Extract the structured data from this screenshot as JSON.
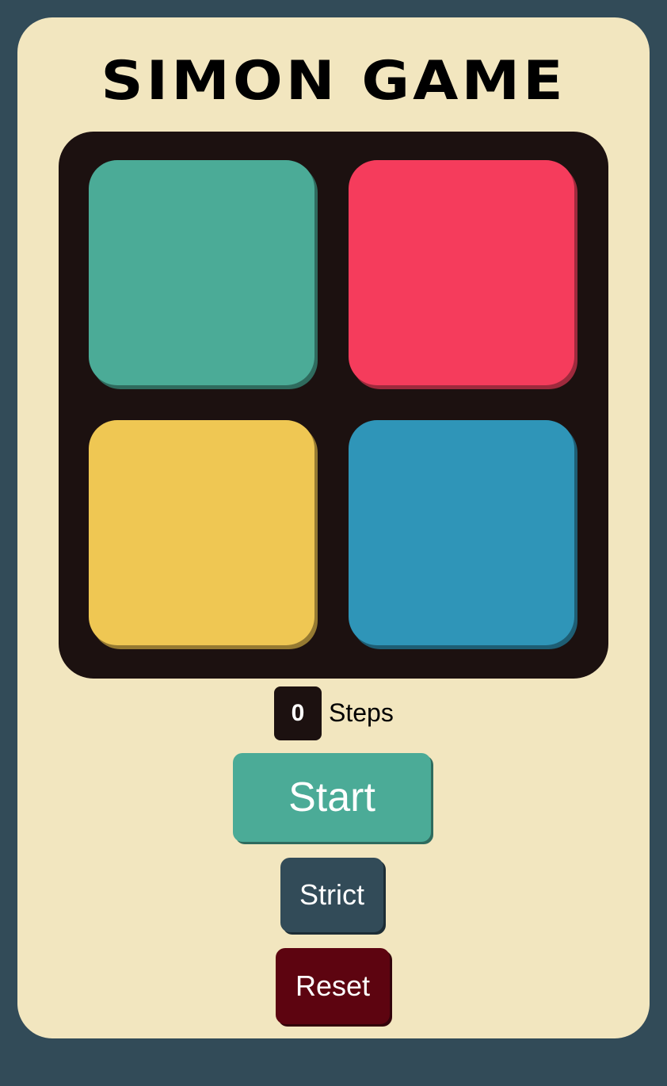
{
  "title": "SIMON GAME",
  "pads": [
    {
      "name": "green",
      "color": "#4bab97",
      "shadow": "#2f6b5e"
    },
    {
      "name": "red",
      "color": "#f53c5c",
      "shadow": "#9e2a3d"
    },
    {
      "name": "yellow",
      "color": "#efc753",
      "shadow": "#957a32"
    },
    {
      "name": "blue",
      "color": "#2f95b8",
      "shadow": "#1e5e74"
    }
  ],
  "steps": {
    "count": "0",
    "label": "Steps"
  },
  "buttons": {
    "start": {
      "label": "Start",
      "color": "#4bab97",
      "shadow": "#2f6b5e"
    },
    "strict": {
      "label": "Strict",
      "color": "#324b58",
      "shadow": "#1d2d35"
    },
    "reset": {
      "label": "Reset",
      "color": "#5d0410",
      "shadow": "#33020a"
    }
  },
  "colors": {
    "background": "#324b58",
    "card": "#f2e6bf",
    "board": "#1c1110"
  }
}
